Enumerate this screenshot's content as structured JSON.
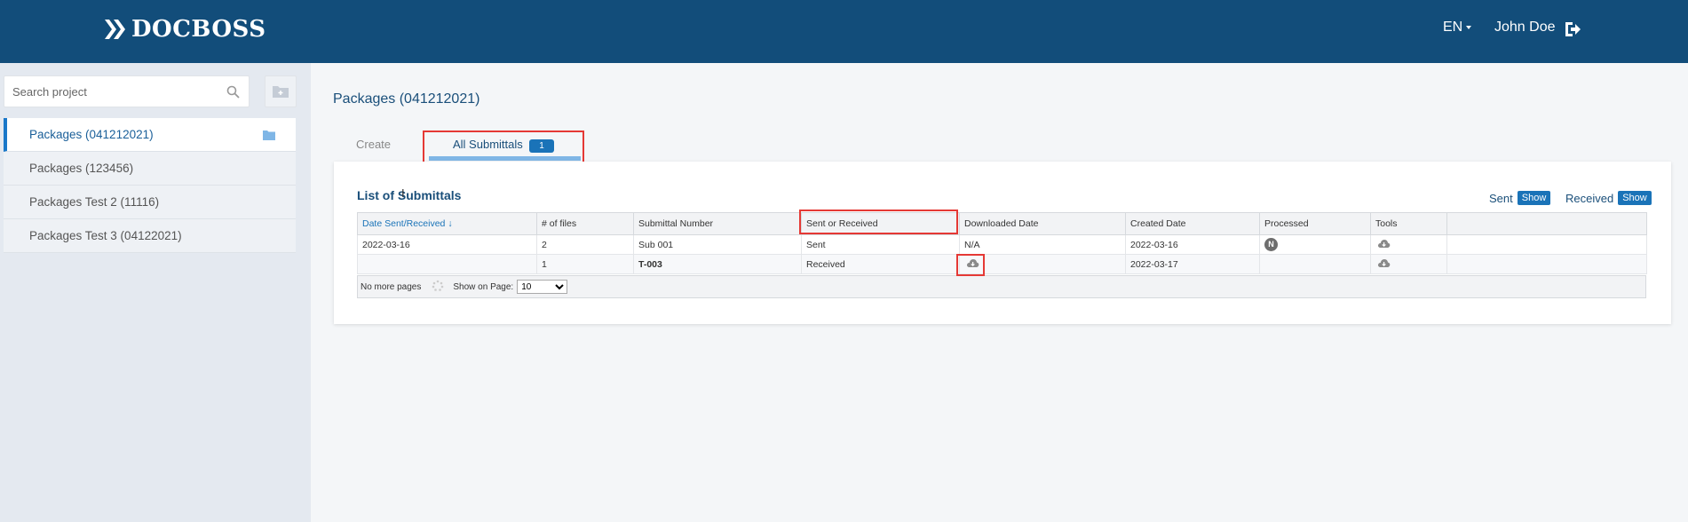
{
  "header": {
    "brand": "DOCBOSS",
    "language": "EN",
    "user_name": "John Doe",
    "brand_color": "#124d7a"
  },
  "sidebar": {
    "search_placeholder": "Search project",
    "projects": [
      {
        "label": "Packages (041212021)",
        "active": true
      },
      {
        "label": "Packages (123456)",
        "active": false
      },
      {
        "label": "Packages Test 2 (11116)",
        "active": false
      },
      {
        "label": "Packages Test 3 (04122021)",
        "active": false
      }
    ]
  },
  "main": {
    "title": "Packages (041212021)",
    "tabs": [
      {
        "label": "Create"
      },
      {
        "label": "All Submittals",
        "badge": "1"
      }
    ],
    "list_title": "List of Submittals",
    "filters": {
      "sent_label": "Sent",
      "received_label": "Received",
      "show_label": "Show"
    },
    "table": {
      "headers": [
        "Date Sent/Received",
        "# of files",
        "Submittal Number",
        "Sent or Received",
        "Downloaded Date",
        "Created Date",
        "Processed",
        "Tools"
      ],
      "sort_indicator": "↓",
      "rows": [
        {
          "date": "2022-03-16",
          "files": "2",
          "number": "Sub 001",
          "sent_received": "Sent",
          "downloaded": "N/A",
          "created": "2022-03-16",
          "processed": "N"
        },
        {
          "date": "",
          "files": "1",
          "number": "T-003",
          "sent_received": "Received",
          "downloaded": "",
          "created": "2022-03-17",
          "processed": ""
        }
      ]
    },
    "pager": {
      "no_more": "No more pages",
      "show_on_page": "Show on Page:",
      "page_size": "10"
    }
  }
}
